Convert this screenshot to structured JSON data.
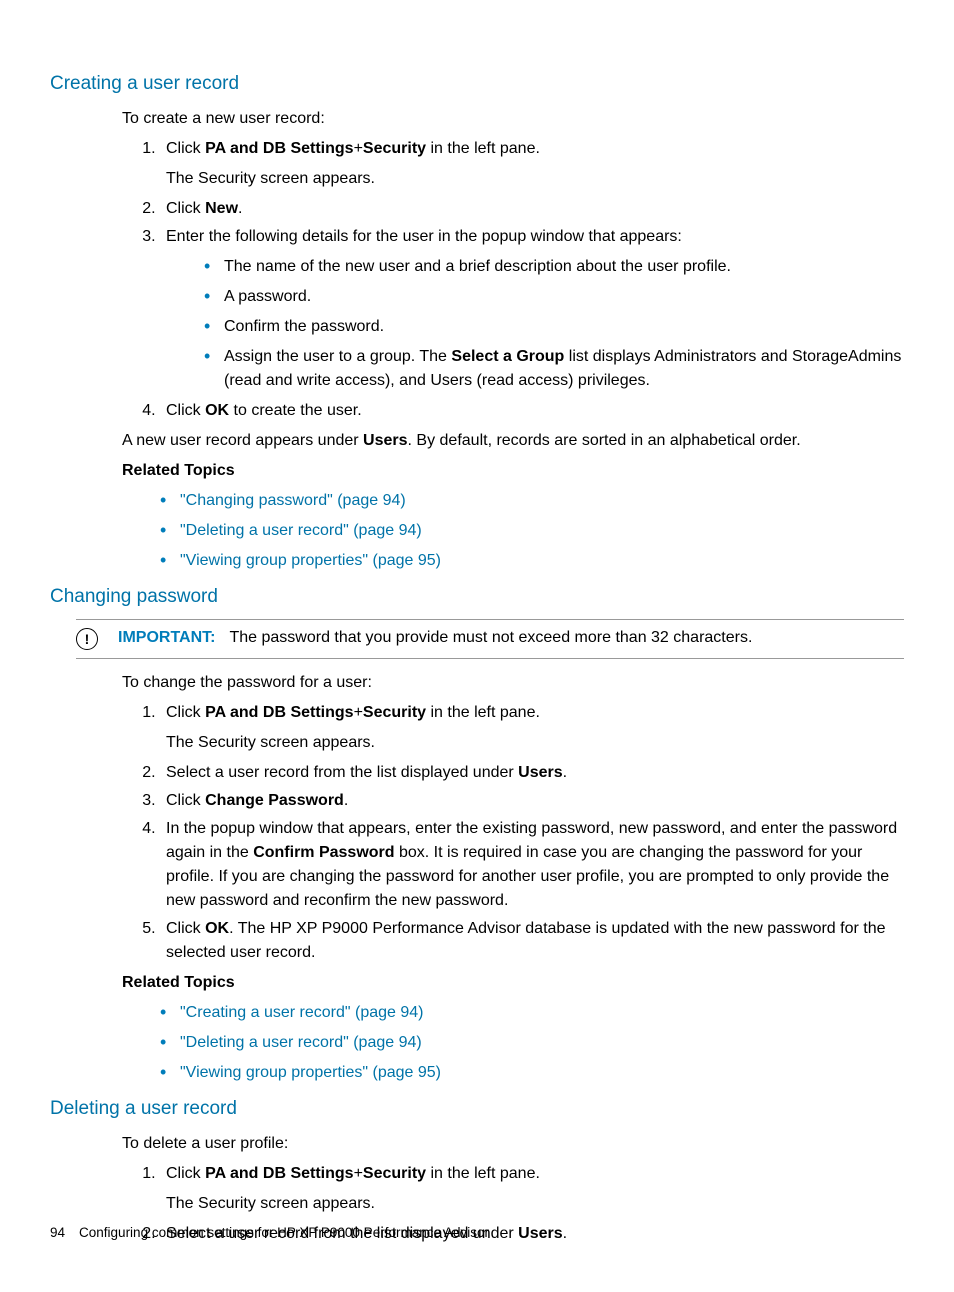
{
  "sections": {
    "creating": {
      "heading": "Creating a user record",
      "intro": "To create a new user record:",
      "step1_pre": "Click ",
      "step1_b1": "PA and DB Settings",
      "step1_plus": "+",
      "step1_b2": "Security",
      "step1_post": " in the left pane.",
      "step1_sub": "The Security screen appears.",
      "step2_pre": "Click ",
      "step2_b": "New",
      "step2_post": ".",
      "step3": "Enter the following details for the user in the popup window that appears:",
      "step3_bullets": [
        "The name of the new user and a brief description about the user profile.",
        "A password.",
        "Confirm the password."
      ],
      "step3_b4_pre": "Assign the user to a group. The ",
      "step3_b4_b": "Select a Group",
      "step3_b4_post": " list displays Administrators and StorageAdmins (read and write access), and Users (read access) privileges.",
      "step4_pre": "Click ",
      "step4_b": "OK",
      "step4_post": " to create the user.",
      "outro_pre": "A new user record appears under ",
      "outro_b": "Users",
      "outro_post": ". By default, records are sorted in an alphabetical order.",
      "related_label": "Related Topics",
      "related": [
        "\"Changing password\" (page 94)",
        "\"Deleting a user record\" (page 94)",
        "\"Viewing group properties\" (page 95)"
      ]
    },
    "changing": {
      "heading": "Changing password",
      "note_label": "IMPORTANT:",
      "note_text": "The password that you provide must not exceed more than 32 characters.",
      "intro": "To change the password for a user:",
      "step1_pre": "Click ",
      "step1_b1": "PA and DB Settings",
      "step1_plus": "+",
      "step1_b2": "Security",
      "step1_post": " in the left pane.",
      "step1_sub": "The Security screen appears.",
      "step2_pre": "Select a user record from the list displayed under ",
      "step2_b": "Users",
      "step2_post": ".",
      "step3_pre": "Click ",
      "step3_b": "Change Password",
      "step3_post": ".",
      "step4_pre": "In the popup window that appears, enter the existing password, new password, and enter the password again in the ",
      "step4_b": "Confirm Password",
      "step4_post": " box. It is required in case you are changing the password for your profile. If you are changing the password for another user profile, you are prompted to only provide the new password and reconfirm the new password.",
      "step5_pre": "Click ",
      "step5_b": "OK",
      "step5_post": ". The HP XP P9000 Performance Advisor database is updated with the new password for the selected user record.",
      "related_label": "Related Topics",
      "related": [
        "\"Creating a user record\" (page 94)",
        "\"Deleting a user record\" (page 94)",
        "\"Viewing group properties\" (page 95)"
      ]
    },
    "deleting": {
      "heading": "Deleting a user record",
      "intro": "To delete a user profile:",
      "step1_pre": "Click ",
      "step1_b1": "PA and DB Settings",
      "step1_plus": "+",
      "step1_b2": "Security",
      "step1_post": " in the left pane.",
      "step1_sub": "The Security screen appears.",
      "step2_pre": "Select a user record from the list displayed under ",
      "step2_b": "Users",
      "step2_post": "."
    }
  },
  "footer": {
    "page": "94",
    "title": "Configuring common settings for HP XP P9000 Performance Advisor"
  }
}
